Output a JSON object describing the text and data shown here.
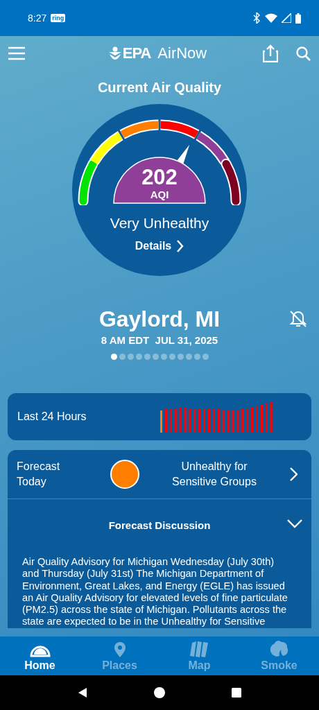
{
  "status_bar": {
    "time": "8:27",
    "notification": "ring"
  },
  "app_bar": {
    "brand": "EPA",
    "title": "AirNow"
  },
  "heading": "Current Air Quality",
  "gauge": {
    "value": "202",
    "unit": "AQI",
    "color": "#8f3f97",
    "category": "Very Unhealthy",
    "details": "Details"
  },
  "location": {
    "name": "Gaylord, MI",
    "time": "8 AM EDT  JUL 31, 2025",
    "alerts_muted": true
  },
  "page_dots": [
    {
      "selected": true
    },
    {
      "selected": false
    },
    {
      "selected": false
    },
    {
      "selected": false
    },
    {
      "selected": false
    },
    {
      "selected": false
    },
    {
      "selected": false
    },
    {
      "selected": false
    },
    {
      "selected": false
    },
    {
      "selected": false
    },
    {
      "selected": false
    },
    {
      "selected": false
    }
  ],
  "history": {
    "label": "Last 24 Hours"
  },
  "forecast": {
    "label": "Forecast\nToday",
    "category": "Unhealthy for\nSensitive Groups",
    "color": "#ff7e00"
  },
  "discussion": {
    "title": "Forecast Discussion",
    "expanded": true,
    "text": "Air Quality Advisory for Michigan Wednesday (July 30th) and Thursday (July 31st) The Michigan Department of Environment, Great Lakes, and Energy (EGLE) has issued an Air Quality Advisory for elevated levels of fine particulate (PM2.5) across the state of Michigan. Pollutants across the state are expected to be in the Unhealthy for Sensitive"
  },
  "bottom_nav": [
    {
      "label": "Home",
      "selected": true
    },
    {
      "label": "Places",
      "selected": false
    },
    {
      "label": "Map",
      "selected": false
    },
    {
      "label": "Smoke",
      "selected": false
    }
  ]
}
